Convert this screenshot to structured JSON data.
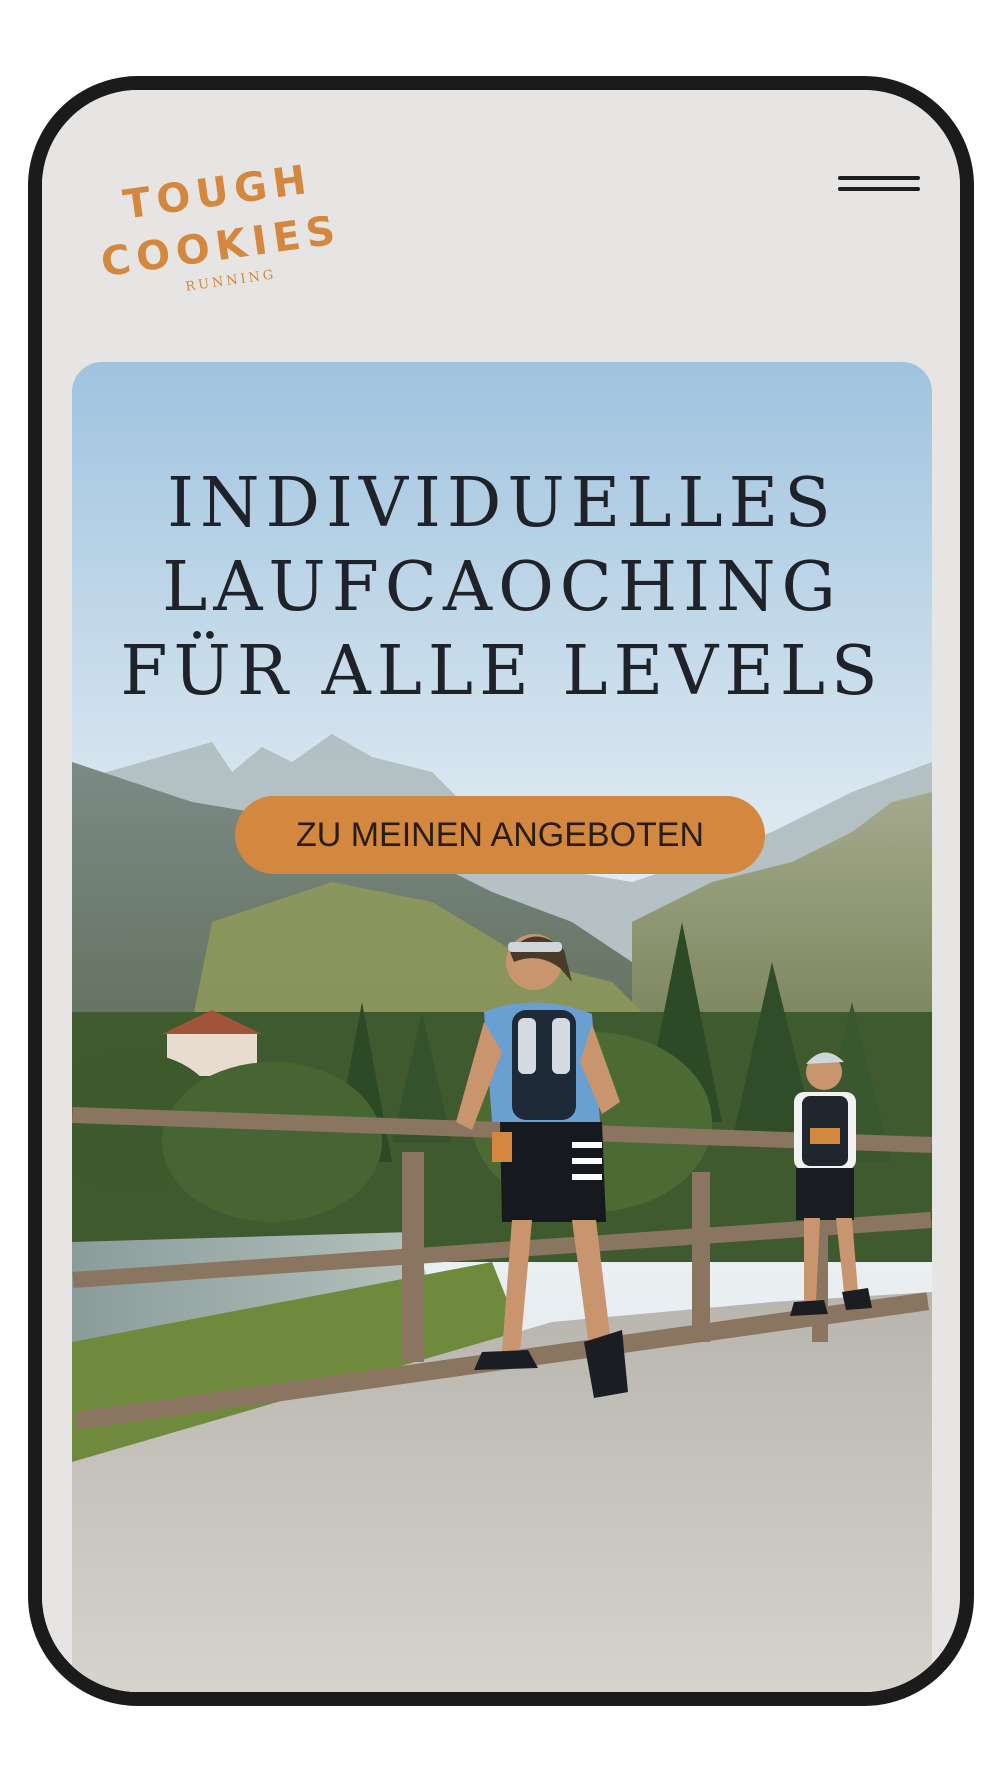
{
  "brand": {
    "logo_line1": "TOUGH",
    "logo_line2": "COOKIES",
    "logo_sub": "RUNNING",
    "accent_color": "#d3873f"
  },
  "header": {
    "menu_icon": "hamburger-menu-icon"
  },
  "hero": {
    "headline_line1": "INDIVIDUELLES",
    "headline_line2": "LAUFCAOCHING",
    "headline_line3": "FÜR ALLE LEVELS",
    "cta_label": "ZU MEINEN ANGEBOTEN",
    "cta_color": "#d3873f"
  },
  "stray_mark": "„"
}
